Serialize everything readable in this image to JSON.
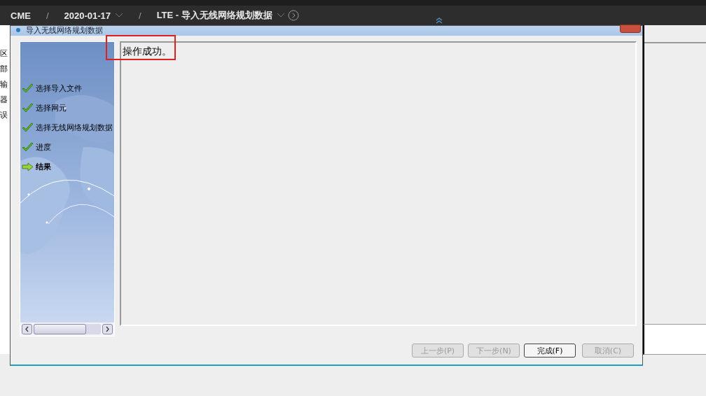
{
  "breadcrumb": [
    {
      "kind": "item",
      "label": "CME",
      "dropdown": false
    },
    {
      "kind": "separator",
      "label": "/"
    },
    {
      "kind": "item",
      "label": "2020-01-17",
      "dropdown": true
    },
    {
      "kind": "separator",
      "label": "/"
    },
    {
      "kind": "item",
      "label": "LTE - 导入无线网络规划数据",
      "dropdown": true
    }
  ],
  "background_texts": [
    "区",
    "部",
    "输",
    "器",
    "误"
  ],
  "dialog": {
    "title": "导入无线网络规划数据",
    "steps": [
      {
        "label": "选择导入文件",
        "kind": "done"
      },
      {
        "label": "选择网元",
        "kind": "done"
      },
      {
        "label": "选择无线网络规划数据",
        "kind": "done"
      },
      {
        "label": "进度",
        "kind": "done"
      },
      {
        "label": "结果",
        "kind": "current"
      }
    ],
    "message": "操作成功。",
    "buttons": [
      {
        "label": "上一步(P)",
        "disabled": true,
        "default": false
      },
      {
        "label": "下一步(N)",
        "disabled": true,
        "default": false
      },
      {
        "label": "完成(F)",
        "disabled": false,
        "default": true
      },
      {
        "label": "取消(C)",
        "disabled": true,
        "default": false
      }
    ]
  }
}
